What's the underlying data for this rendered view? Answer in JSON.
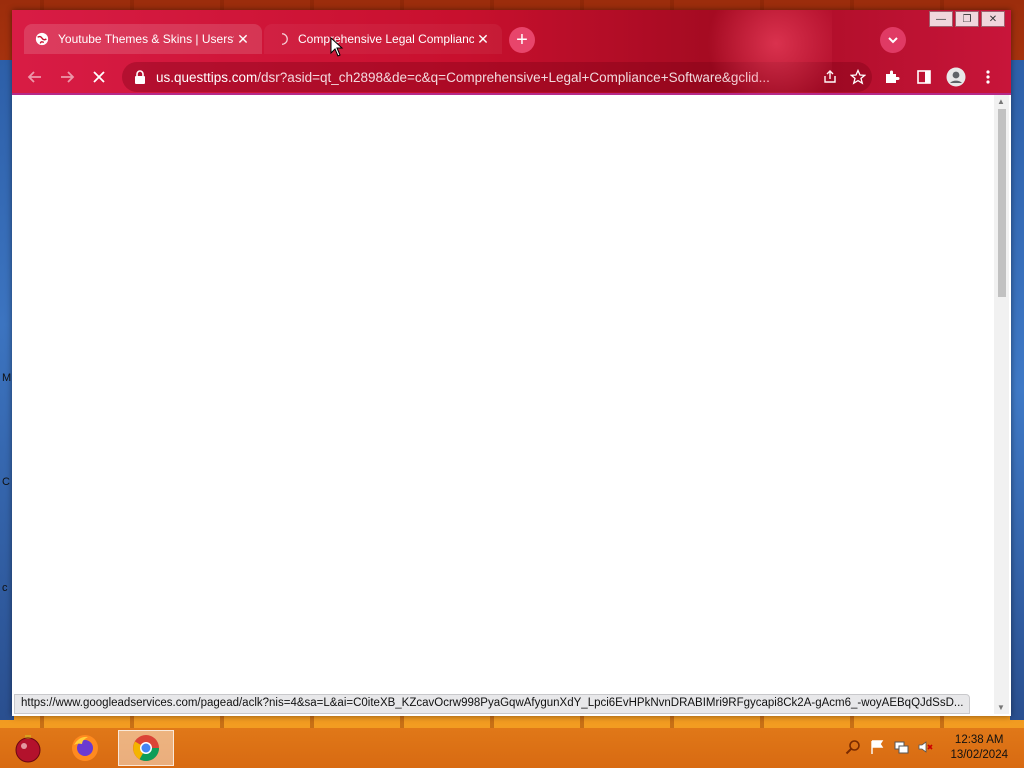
{
  "desktop": {
    "side_letters": [
      "M",
      "C",
      "c"
    ]
  },
  "browser": {
    "tabs": [
      {
        "title": "Youtube Themes & Skins | Userst",
        "icon": "globe-icon",
        "active": false
      },
      {
        "title": "Comprehensive Legal Complianc",
        "icon": "loading-icon",
        "active": true
      }
    ],
    "new_tab_icon": "plus-icon",
    "tab_search_icon": "chevron-down-icon",
    "window_controls": [
      "minimize",
      "restore",
      "close"
    ],
    "nav": {
      "back": "back-arrow-icon",
      "forward": "forward-arrow-icon",
      "reload": "stop-loading-icon"
    },
    "omnibox": {
      "host": "us.questtips.com",
      "path": "/dsr?asid=qt_ch2898&de=c&q=Comprehensive+Legal+Compliance+Software&gclid..."
    },
    "status_url": "https://www.googleadservices.com/pagead/aclk?nis=4&sa=L&ai=C0iteXB_KZcavOcrw998PyaGqwAfygunXdY_Lpci6EvHPkNvnDRABIMri9RFgycapi8Ck2A-gAcm6_-woyAEBqQJdSsD...",
    "accent_color": "#c8102e"
  },
  "taskbar": {
    "apps": [
      {
        "name": "ornament-app-icon"
      },
      {
        "name": "firefox-icon"
      },
      {
        "name": "chrome-icon",
        "active": true
      }
    ],
    "tray_icons": [
      "search-tray-icon",
      "flag-icon",
      "network-icon",
      "volume-muted-icon"
    ],
    "time": "12:38 AM",
    "date": "13/02/2024"
  }
}
